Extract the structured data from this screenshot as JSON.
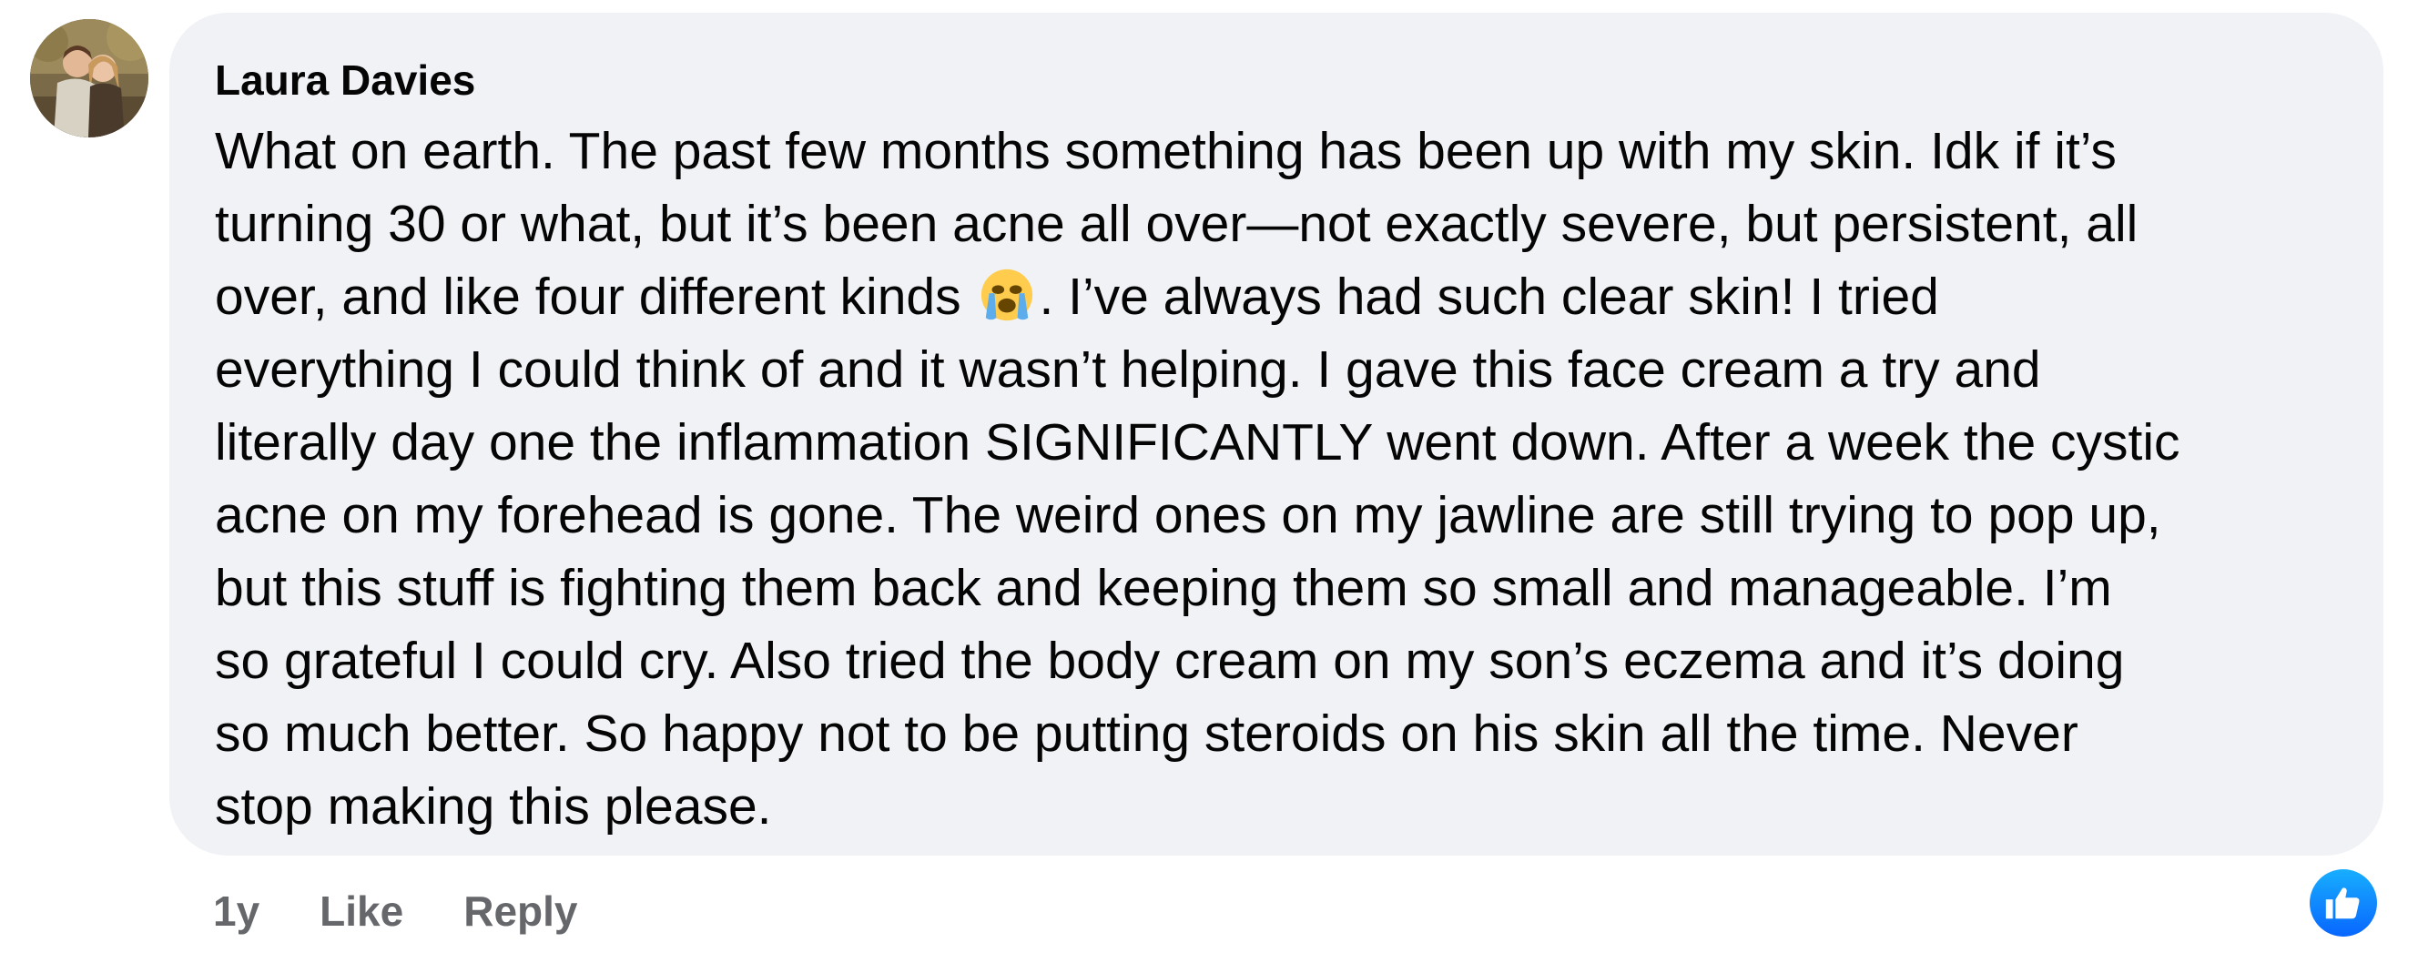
{
  "comment": {
    "author": "Laura Davies",
    "body_lines": [
      "What on earth. The past few months something has been up with my skin. Idk if it’s",
      "turning 30 or what, but it’s been acne all over—not exactly severe, but persistent, all",
      "over, and like four different kinds",
      ". I’ve always had such clear skin! I tried",
      "everything I could think of and it wasn’t helping. I gave this face cream a try and",
      "literally day one the inflammation SIGNIFICANTLY went down. After a week the cystic",
      "acne on my forehead is gone. The weird ones on my jawline are still trying to pop up,",
      "but this stuff is fighting them back and keeping them so small and manageable. I’m",
      "so grateful I could cry. Also tried the body cream on my son’s eczema and it’s doing",
      "so much better. So happy not to be putting steroids on his skin all the time. Never",
      "stop making this please."
    ],
    "emoji": "loudly-crying-face-icon",
    "timestamp": "1y",
    "like_label": "Like",
    "reply_label": "Reply",
    "reaction_icon": "thumbs-up-icon"
  },
  "colors": {
    "bubble": "#f0f2f5",
    "text": "#050505",
    "secondary_text": "#65676b",
    "like_blue": "#0866ff"
  }
}
